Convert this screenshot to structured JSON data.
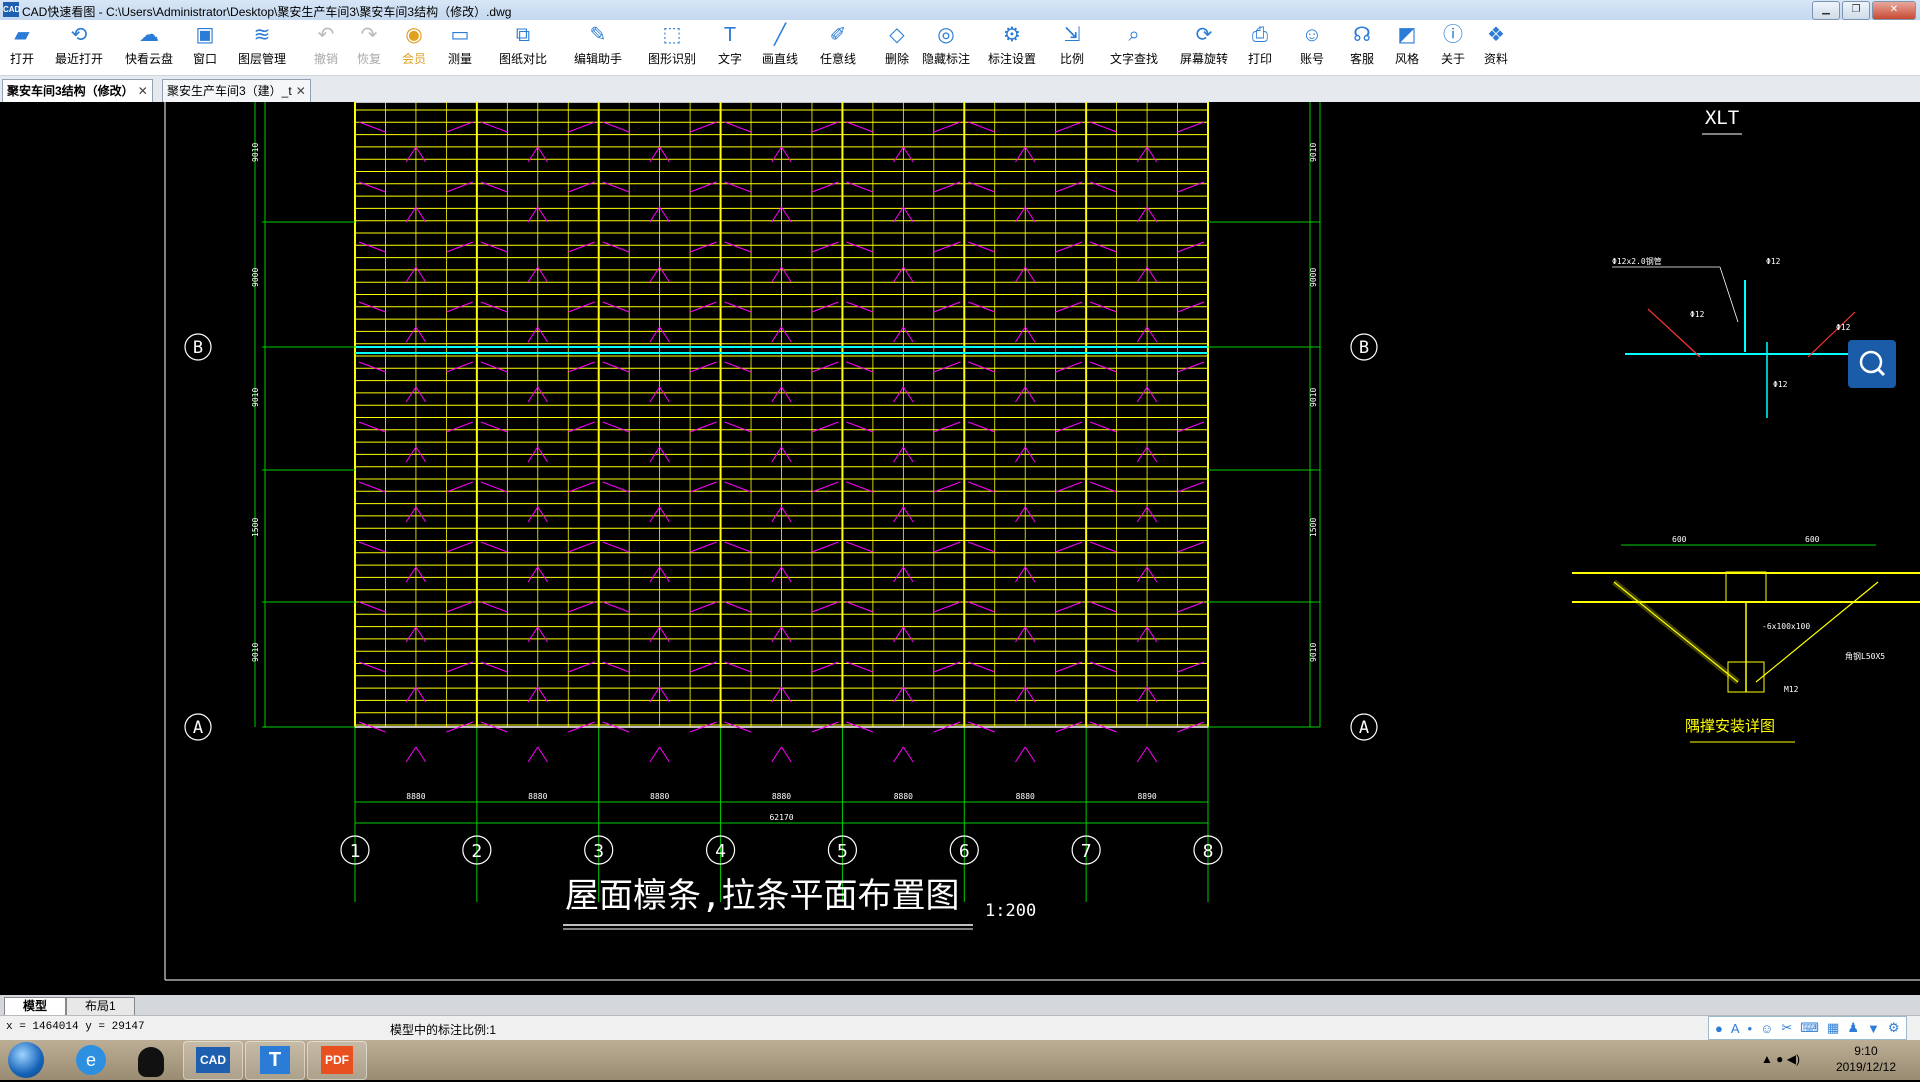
{
  "window": {
    "title": "CAD快速看图 - C:\\Users\\Administrator\\Desktop\\聚安生产车间3\\聚安车间3结构（修改）.dwg",
    "app_icon_text": "CAD"
  },
  "toolbar": {
    "items": [
      {
        "label": "打开",
        "icon": "folder-open-icon"
      },
      {
        "label": "最近打开",
        "icon": "history-icon"
      },
      {
        "label": "快看云盘",
        "icon": "cloud-icon"
      },
      {
        "label": "窗口",
        "icon": "window-icon"
      },
      {
        "label": "图层管理",
        "icon": "layers-icon"
      },
      {
        "label": "撤销",
        "icon": "undo-icon",
        "disabled": true
      },
      {
        "label": "恢复",
        "icon": "redo-icon",
        "disabled": true
      },
      {
        "label": "会员",
        "icon": "vip-icon",
        "vip": true
      },
      {
        "label": "测量",
        "icon": "ruler-icon"
      },
      {
        "label": "图纸对比",
        "icon": "compare-icon"
      },
      {
        "label": "编辑助手",
        "icon": "edit-assistant-icon"
      },
      {
        "label": "图形识别",
        "icon": "shape-recognition-icon"
      },
      {
        "label": "文字",
        "icon": "text-icon"
      },
      {
        "label": "画直线",
        "icon": "line-icon"
      },
      {
        "label": "任意线",
        "icon": "freehand-icon"
      },
      {
        "label": "删除",
        "icon": "eraser-icon"
      },
      {
        "label": "隐藏标注",
        "icon": "hide-annotation-icon"
      },
      {
        "label": "标注设置",
        "icon": "annotation-settings-icon"
      },
      {
        "label": "比例",
        "icon": "scale-icon"
      },
      {
        "label": "文字查找",
        "icon": "text-search-icon"
      },
      {
        "label": "屏幕旋转",
        "icon": "rotate-icon"
      },
      {
        "label": "打印",
        "icon": "printer-icon"
      },
      {
        "label": "账号",
        "icon": "user-icon"
      },
      {
        "label": "客服",
        "icon": "headset-icon"
      },
      {
        "label": "风格",
        "icon": "style-icon"
      },
      {
        "label": "关于",
        "icon": "info-icon"
      },
      {
        "label": "资料",
        "icon": "materials-icon"
      }
    ]
  },
  "tabs": [
    {
      "label": "聚安车间3结构（修改）",
      "active": true
    },
    {
      "label": "聚安生产车间3（建）_t",
      "active": false
    }
  ],
  "drawing": {
    "title": "屋面檩条,拉条平面布置图",
    "scale": "1:200",
    "axes_x": [
      "1",
      "2",
      "3",
      "4",
      "5",
      "6",
      "7",
      "8"
    ],
    "axes_y": [
      "B",
      "A"
    ],
    "bay_dims": [
      "8880",
      "8880",
      "8880",
      "8880",
      "8880",
      "8880",
      "8890"
    ],
    "total_dim": "62170",
    "side_dims": [
      "9010",
      "9000",
      "9010",
      "1500",
      "9010"
    ],
    "detail_label_top": "XLT",
    "detail_label_bottom": "隅撑安装详图",
    "detail_notes": [
      "Φ12x2.0钢管",
      "Φ12",
      "Φ12",
      "Φ12",
      "Φ12",
      "600",
      "600",
      "-6x100x100",
      "角钢L50X5",
      "M12"
    ]
  },
  "layout_tabs": [
    "模型",
    "布局1"
  ],
  "status": {
    "coords": "x = 1464014  y = 29147",
    "scale_info": "模型中的标注比例:1"
  },
  "taskbar": {
    "apps": [
      "e",
      "QQ",
      "CAD",
      "T",
      "PDF"
    ],
    "time": "9:10",
    "date": "2019/12/12"
  },
  "colors": {
    "purlin": "#ffff00",
    "brace": "#ff00ff",
    "axis": "#00cc00",
    "tie": "#00ffff",
    "accent": "#2a7cd6"
  }
}
